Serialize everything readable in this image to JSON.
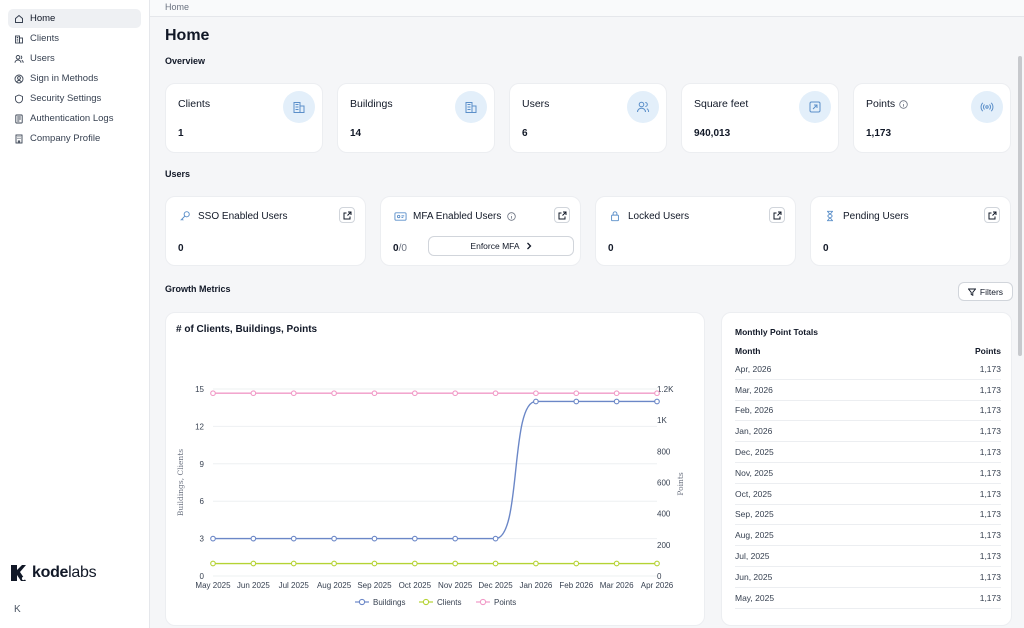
{
  "sidebar": {
    "items": [
      {
        "label": "Home",
        "icon": "home-icon",
        "active": true
      },
      {
        "label": "Clients",
        "icon": "building-icon"
      },
      {
        "label": "Users",
        "icon": "users-icon"
      },
      {
        "label": "Sign in Methods",
        "icon": "sign-in-icon"
      },
      {
        "label": "Security Settings",
        "icon": "shield-icon"
      },
      {
        "label": "Authentication Logs",
        "icon": "log-icon"
      },
      {
        "label": "Company Profile",
        "icon": "company-icon"
      }
    ],
    "logo": {
      "bold": "kode",
      "light": "labs"
    },
    "collapse_label": "K"
  },
  "breadcrumb": "Home",
  "page_title": "Home",
  "sections": {
    "overview": "Overview",
    "users": "Users",
    "growth": "Growth Metrics"
  },
  "overview_cards": [
    {
      "title": "Clients",
      "value": "1",
      "icon": "building-icon"
    },
    {
      "title": "Buildings",
      "value": "14",
      "icon": "building-icon"
    },
    {
      "title": "Users",
      "value": "6",
      "icon": "users-icon"
    },
    {
      "title": "Square feet",
      "value": "940,013",
      "icon": "expand-arrow-icon"
    },
    {
      "title": "Points",
      "value": "1,173",
      "icon": "signal-icon",
      "info": true
    }
  ],
  "user_cards": [
    {
      "title": "SSO Enabled Users",
      "value": "0",
      "icon": "key-icon"
    },
    {
      "title": "MFA Enabled Users",
      "value": "0",
      "value_suffix": "/0",
      "icon": "mfa-icon",
      "info": true,
      "button": "Enforce MFA"
    },
    {
      "title": "Locked Users",
      "value": "0",
      "icon": "lock-icon"
    },
    {
      "title": "Pending Users",
      "value": "0",
      "icon": "hourglass-icon"
    }
  ],
  "filters_label": "Filters",
  "chart_data": {
    "type": "line",
    "title": "# of Clients, Buildings, Points",
    "categories": [
      "May 2025",
      "Jun 2025",
      "Jul 2025",
      "Aug 2025",
      "Sep 2025",
      "Oct 2025",
      "Nov 2025",
      "Dec 2025",
      "Jan 2026",
      "Feb 2026",
      "Mar 2026",
      "Apr 2026"
    ],
    "ylabel": "Buildings, Clients",
    "y2label": "Points",
    "ylim": [
      0,
      15
    ],
    "y_ticks": [
      "0",
      "3",
      "6",
      "9",
      "12",
      "15"
    ],
    "y2lim": [
      0,
      1200
    ],
    "y2_ticks": [
      "0",
      "200",
      "400",
      "600",
      "800",
      "1K",
      "1.2K"
    ],
    "series": [
      {
        "name": "Buildings",
        "axis": "left",
        "color": "#6b87c7",
        "values": [
          3,
          3,
          3,
          3,
          3,
          3,
          3,
          3,
          14,
          14,
          14,
          14
        ]
      },
      {
        "name": "Clients",
        "axis": "left",
        "color": "#b5d334",
        "values": [
          1,
          1,
          1,
          1,
          1,
          1,
          1,
          1,
          1,
          1,
          1,
          1
        ]
      },
      {
        "name": "Points",
        "axis": "right",
        "color": "#f19ac7",
        "values": [
          1173,
          1173,
          1173,
          1173,
          1173,
          1173,
          1173,
          1173,
          1173,
          1173,
          1173,
          1173
        ]
      }
    ],
    "grid": true,
    "legend": "bottom"
  },
  "table": {
    "title": "Monthly Point Totals",
    "columns": [
      "Month",
      "Points"
    ],
    "rows": [
      [
        "Apr, 2026",
        "1,173"
      ],
      [
        "Mar, 2026",
        "1,173"
      ],
      [
        "Feb, 2026",
        "1,173"
      ],
      [
        "Jan, 2026",
        "1,173"
      ],
      [
        "Dec, 2025",
        "1,173"
      ],
      [
        "Nov, 2025",
        "1,173"
      ],
      [
        "Oct, 2025",
        "1,173"
      ],
      [
        "Sep, 2025",
        "1,173"
      ],
      [
        "Aug, 2025",
        "1,173"
      ],
      [
        "Jul, 2025",
        "1,173"
      ],
      [
        "Jun, 2025",
        "1,173"
      ],
      [
        "May, 2025",
        "1,173"
      ]
    ]
  },
  "colors": {
    "accent_bg": "#e3effa",
    "accent": "#5b8fc9"
  }
}
